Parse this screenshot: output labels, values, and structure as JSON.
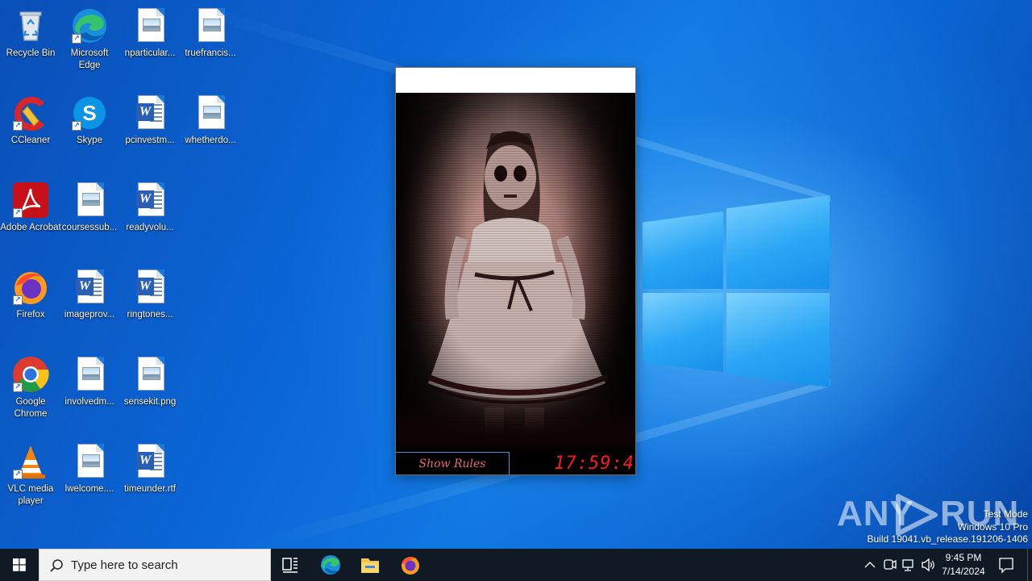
{
  "desktop": {
    "icons": [
      {
        "label": "Recycle Bin",
        "icon": "recycle-bin-icon"
      },
      {
        "label": "Microsoft Edge",
        "icon": "edge-icon"
      },
      {
        "label": "nparticular...",
        "icon": "image-file-icon"
      },
      {
        "label": "truefrancis...",
        "icon": "image-file-icon"
      },
      {
        "label": "CCleaner",
        "icon": "ccleaner-icon"
      },
      {
        "label": "Skype",
        "icon": "skype-icon"
      },
      {
        "label": "pcinvestm...",
        "icon": "word-doc-icon"
      },
      {
        "label": "whetherdo...",
        "icon": "image-file-icon"
      },
      {
        "label": "Adobe Acrobat",
        "icon": "acrobat-icon"
      },
      {
        "label": "coursessub...",
        "icon": "image-file-icon"
      },
      {
        "label": "readyvolu...",
        "icon": "word-doc-icon"
      },
      {
        "label": "Firefox",
        "icon": "firefox-icon"
      },
      {
        "label": "imageprov...",
        "icon": "word-doc-icon"
      },
      {
        "label": "ringtones...",
        "icon": "word-doc-icon"
      },
      {
        "label": "Google Chrome",
        "icon": "chrome-icon"
      },
      {
        "label": "involvedm...",
        "icon": "image-file-icon"
      },
      {
        "label": "sensekit.png",
        "icon": "image-file-icon"
      },
      {
        "label": "VLC media player",
        "icon": "vlc-icon"
      },
      {
        "label": "lwelcome....",
        "icon": "image-file-icon"
      },
      {
        "label": "timeunder.rtf",
        "icon": "word-doc-icon"
      }
    ]
  },
  "app_window": {
    "show_rules_label": "Show Rules",
    "timer": "17:59:4"
  },
  "watermark": {
    "brand_left": "ANY",
    "brand_right": "RUN"
  },
  "build_info": {
    "line1": "Test Mode",
    "line2": "Windows 10 Pro",
    "line3": "Build 19041.vb_release.191206-1406"
  },
  "taskbar": {
    "search_placeholder": "Type here to search",
    "pinned": [
      "edge-icon",
      "file-explorer-icon",
      "firefox-icon"
    ],
    "clock_time": "9:45 PM",
    "clock_date": "7/14/2024"
  },
  "colors": {
    "taskbar_bg": "#101a24",
    "timer_red": "#ff1a1a",
    "rules_text": "#e86a6a",
    "rules_border": "#4a8fd8"
  }
}
